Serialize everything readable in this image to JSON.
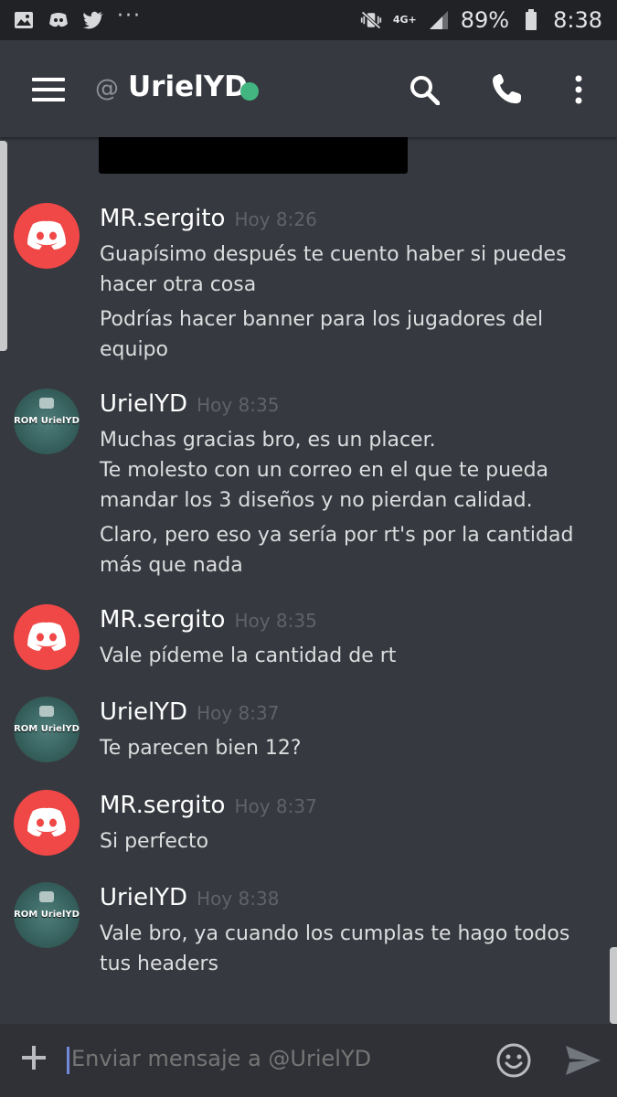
{
  "status_bar": {
    "network": "4G+",
    "battery": "89%",
    "time": "8:38",
    "overflow": "···"
  },
  "header": {
    "at_symbol": "@",
    "title": "UrielYD"
  },
  "messages": [
    {
      "author": "MR.sergito",
      "timestamp": "Hoy 8:26",
      "avatar": "discord-logo",
      "lines": [
        "Guapísimo después te cuento haber si puedes hacer otra cosa",
        "Podrías hacer banner para los jugadores del equipo"
      ]
    },
    {
      "author": "UrielYD",
      "timestamp": "Hoy 8:35",
      "avatar": "rom-urielyd",
      "avatar_label": "ROM UrielYD",
      "lines": [
        "Muchas gracias bro, es un placer.",
        "Te molesto con un correo en el que te pueda mandar los 3 diseños y no pierdan calidad.",
        "Claro, pero eso ya sería por rt's por la cantidad más que nada"
      ]
    },
    {
      "author": "MR.sergito",
      "timestamp": "Hoy 8:35",
      "avatar": "discord-logo",
      "lines": [
        "Vale pídeme la cantidad de rt"
      ]
    },
    {
      "author": "UrielYD",
      "timestamp": "Hoy 8:37",
      "avatar": "rom-urielyd",
      "avatar_label": "ROM UrielYD",
      "lines": [
        "Te parecen bien 12?"
      ]
    },
    {
      "author": "MR.sergito",
      "timestamp": "Hoy 8:37",
      "avatar": "discord-logo",
      "lines": [
        "Si perfecto"
      ]
    },
    {
      "author": "UrielYD",
      "timestamp": "Hoy 8:38",
      "avatar": "rom-urielyd",
      "avatar_label": "ROM UrielYD",
      "lines": [
        "Vale bro, ya cuando los cumplas te hago todos tus headers"
      ]
    }
  ],
  "input": {
    "placeholder": "Enviar mensaje a @UrielYD"
  },
  "colors": {
    "background": "#36393f",
    "status_bar": "#202225",
    "online": "#43b581",
    "discord_red": "#f04747",
    "text": "#dcddde",
    "timestamp": "#5f6368"
  }
}
